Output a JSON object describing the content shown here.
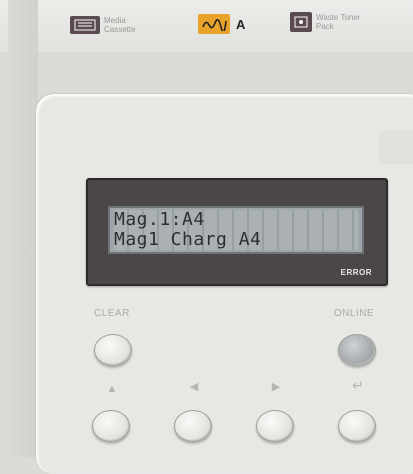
{
  "labels": {
    "media_cassette": "Media\nCassette",
    "toner_letter": "A",
    "waste_toner": "Waste Toner\nPack"
  },
  "display": {
    "line1": "Mag.1:A4",
    "line2": "Mag1 Charg A4",
    "error_indicator": "ERROR"
  },
  "buttons": {
    "clear": "CLEAR",
    "online": "ONLINE"
  },
  "icons": {
    "up": "▲",
    "left": "◀",
    "right": "▶",
    "enter": "↵"
  },
  "colors": {
    "panel": "#e7e8e4",
    "bezel": "#4b4648",
    "lcd": "#9fa6a9",
    "toner_icon": "#e8a32a",
    "dark_icon": "#5a4a52"
  }
}
